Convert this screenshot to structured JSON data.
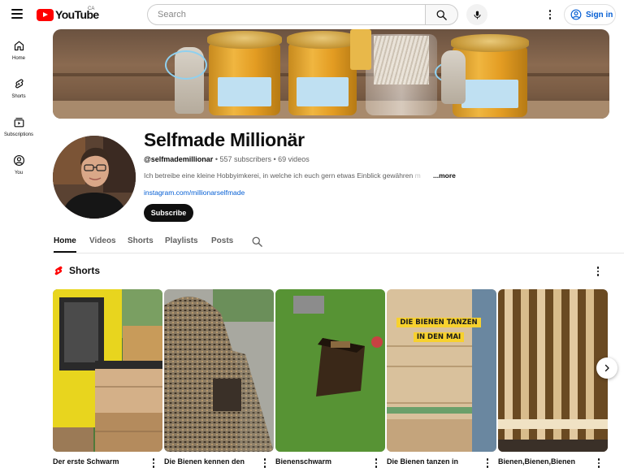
{
  "header": {
    "logo_text": "YouTube",
    "country_code": "CA",
    "search_placeholder": "Search",
    "signin_label": "Sign in"
  },
  "sidebar": {
    "items": [
      {
        "label": "Home",
        "icon": "home-icon"
      },
      {
        "label": "Shorts",
        "icon": "shorts-icon"
      },
      {
        "label": "Subscriptions",
        "icon": "subscriptions-icon"
      },
      {
        "label": "You",
        "icon": "you-icon"
      }
    ]
  },
  "channel": {
    "name": "Selfmade Millionär",
    "handle": "@selfmademillionar",
    "subscribers": "557 subscribers",
    "videos": "69 videos",
    "separator": " • ",
    "description": "Ich betreibe eine kleine Hobbyimkerei, in welche ich euch gern etwas Einblick gewähren",
    "description_fade": " m",
    "more_label": "...more",
    "link": "instagram.com/millionarselfmade",
    "subscribe_label": "Subscribe"
  },
  "tabs": [
    {
      "label": "Home",
      "active": true
    },
    {
      "label": "Videos",
      "active": false
    },
    {
      "label": "Shorts",
      "active": false
    },
    {
      "label": "Playlists",
      "active": false
    },
    {
      "label": "Posts",
      "active": false
    }
  ],
  "shorts_shelf": {
    "title": "Shorts",
    "items": [
      {
        "title": "Der erste Schwarm"
      },
      {
        "title": "Die Bienen kennen den"
      },
      {
        "title": "Bienenschwarm"
      },
      {
        "title": "Die Bienen tanzen in",
        "overlay_line1": "DIE BIENEN TANZEN",
        "overlay_line2": "IN DEN MAI"
      },
      {
        "title": "Bienen,Bienen,Bienen"
      }
    ]
  },
  "colors": {
    "brand_red": "#ff0000",
    "link_blue": "#065fd4",
    "text_primary": "#0f0f0f",
    "text_secondary": "#606060"
  }
}
